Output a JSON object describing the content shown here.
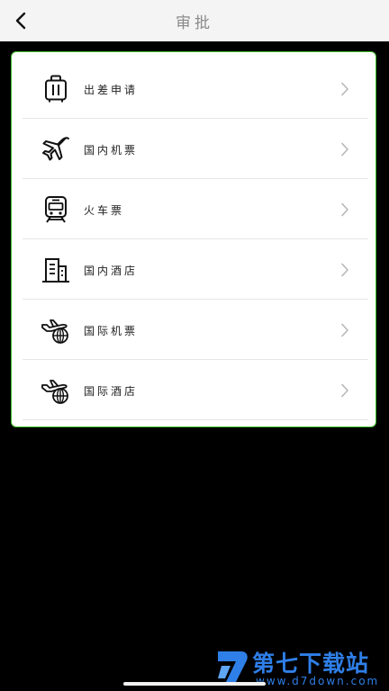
{
  "header": {
    "title": "审批",
    "back_icon": "chevron-left-icon"
  },
  "menu": {
    "items": [
      {
        "label": "出差申请",
        "icon": "luggage-icon"
      },
      {
        "label": "国内机票",
        "icon": "airplane-icon"
      },
      {
        "label": "火车票",
        "icon": "train-icon"
      },
      {
        "label": "国内酒店",
        "icon": "hotel-building-icon"
      },
      {
        "label": "国际机票",
        "icon": "airplane-globe-icon"
      },
      {
        "label": "国际酒店",
        "icon": "airplane-globe-icon"
      }
    ],
    "chevron_icon": "chevron-right-icon"
  },
  "watermark": {
    "brand": "第七下载站",
    "url": "www.d7down.com"
  },
  "colors": {
    "card_border": "#3fbf2a",
    "watermark": "#2f7fe8",
    "header_bg": "#f4f4f4"
  }
}
